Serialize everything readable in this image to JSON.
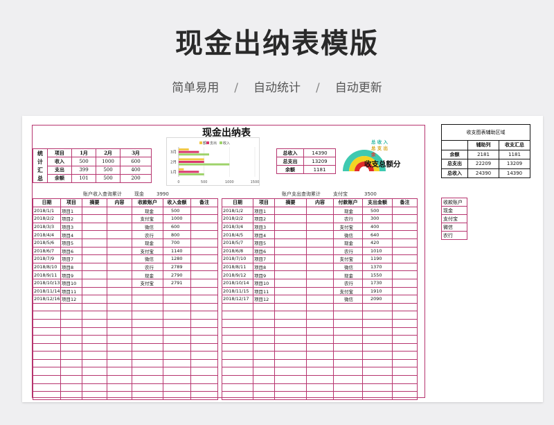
{
  "hero": {
    "title": "现金出纳表模版",
    "features": [
      "简单易用",
      "自动统计",
      "自动更新"
    ],
    "separator": "/"
  },
  "sheet": {
    "title": "现金出纳表",
    "stats": {
      "vertical_label": [
        "统",
        "计",
        "汇",
        "总"
      ],
      "headers": [
        "项目",
        "1月",
        "2月",
        "3月"
      ],
      "rows": [
        [
          "收入",
          "500",
          "1000",
          "600"
        ],
        [
          "支出",
          "399",
          "500",
          "400"
        ],
        [
          "余额",
          "101",
          "500",
          "200"
        ]
      ]
    },
    "totals": [
      {
        "label": "总收入",
        "value": "14390"
      },
      {
        "label": "总支出",
        "value": "13209"
      },
      {
        "label": "余额",
        "value": "1181"
      }
    ],
    "donut": {
      "title": "收支总额分",
      "legend": [
        {
          "label": "总  收  入",
          "color": "#2db7a3"
        },
        {
          "label": "总  支  出",
          "color": "#d2a317"
        },
        {
          "label": "余",
          "color": "#e8342e"
        }
      ],
      "colors": {
        "outer": "#3fc9b0",
        "middle": "#f3d323",
        "inner": "#e02b2b"
      }
    },
    "income_query": {
      "label": "账户收入查询累计",
      "account": "现金",
      "value": "3990"
    },
    "expense_query": {
      "label": "账户支出查询累计",
      "account": "支付宝",
      "value": "3500"
    },
    "income": {
      "headers": [
        "日期",
        "项目",
        "摘要",
        "内容",
        "收款账户",
        "收入金额",
        "备注"
      ],
      "rows": [
        [
          "2018/1/1",
          "项目1",
          "",
          "",
          "现金",
          "500",
          ""
        ],
        [
          "2018/2/2",
          "项目2",
          "",
          "",
          "支付宝",
          "1000",
          ""
        ],
        [
          "2018/3/3",
          "项目3",
          "",
          "",
          "微信",
          "600",
          ""
        ],
        [
          "2018/4/4",
          "项目4",
          "",
          "",
          "农行",
          "800",
          ""
        ],
        [
          "2018/5/6",
          "项目5",
          "",
          "",
          "现金",
          "700",
          ""
        ],
        [
          "2018/6/7",
          "项目6",
          "",
          "",
          "支付宝",
          "1140",
          ""
        ],
        [
          "2018/7/9",
          "项目7",
          "",
          "",
          "微信",
          "1280",
          ""
        ],
        [
          "2018/8/10",
          "项目8",
          "",
          "",
          "农行",
          "2789",
          ""
        ],
        [
          "2018/9/11",
          "项目9",
          "",
          "",
          "现金",
          "2790",
          ""
        ],
        [
          "2018/10/13",
          "项目10",
          "",
          "",
          "支付宝",
          "2791",
          ""
        ],
        [
          "2018/11/14",
          "项目11",
          "",
          "",
          "",
          "",
          ""
        ],
        [
          "2018/12/16",
          "项目12",
          "",
          "",
          "",
          "",
          ""
        ]
      ]
    },
    "expense": {
      "headers": [
        "日期",
        "项目",
        "摘要",
        "内容",
        "付款账户",
        "支出金额",
        "备注"
      ],
      "rows": [
        [
          "2018/1/2",
          "项目1",
          "",
          "",
          "现金",
          "500",
          ""
        ],
        [
          "2018/2/2",
          "项目2",
          "",
          "",
          "农行",
          "300",
          ""
        ],
        [
          "2018/3/4",
          "项目3",
          "",
          "",
          "支付宝",
          "400",
          ""
        ],
        [
          "2018/4/5",
          "项目4",
          "",
          "",
          "微信",
          "640",
          ""
        ],
        [
          "2018/5/7",
          "项目5",
          "",
          "",
          "现金",
          "420",
          ""
        ],
        [
          "2018/6/8",
          "项目6",
          "",
          "",
          "农行",
          "1010",
          ""
        ],
        [
          "2018/7/10",
          "项目7",
          "",
          "",
          "支付宝",
          "1190",
          ""
        ],
        [
          "2018/8/11",
          "项目8",
          "",
          "",
          "微信",
          "1370",
          ""
        ],
        [
          "2018/9/12",
          "项目9",
          "",
          "",
          "现金",
          "1550",
          ""
        ],
        [
          "2018/10/14",
          "项目10",
          "",
          "",
          "农行",
          "1730",
          ""
        ],
        [
          "2018/11/15",
          "项目11",
          "",
          "",
          "支付宝",
          "1910",
          ""
        ],
        [
          "2018/12/17",
          "项目12",
          "",
          "",
          "微信",
          "2090",
          ""
        ]
      ]
    },
    "helper": {
      "title": "收支图表辅助区域",
      "headers": [
        "",
        "辅助列",
        "收支汇总"
      ],
      "rows": [
        [
          "余额",
          "2181",
          "1181"
        ],
        [
          "总支出",
          "22209",
          "13209"
        ],
        [
          "总收入",
          "24390",
          "14390"
        ]
      ]
    },
    "accounts": {
      "header": "收款账户",
      "items": [
        "现金",
        "支付宝",
        "微信",
        "农行"
      ]
    }
  },
  "chart_data": {
    "type": "bar",
    "orientation": "horizontal",
    "categories": [
      "1月",
      "2月",
      "3月"
    ],
    "category_labels": [
      "1月",
      "2月",
      "3月"
    ],
    "series": [
      {
        "name": "余额",
        "color": "#f2c744",
        "values": [
          101,
          500,
          200
        ]
      },
      {
        "name": "支出",
        "color": "#d9386e",
        "values": [
          399,
          500,
          400
        ]
      },
      {
        "name": "收入",
        "color": "#9ed36a",
        "values": [
          500,
          1000,
          600
        ]
      }
    ],
    "legend_labels": [
      "额",
      "支出",
      "收入"
    ],
    "xlim": [
      0,
      1500
    ],
    "xticks": [
      0,
      500,
      1000,
      1500
    ],
    "grid": true,
    "legend": "top"
  }
}
